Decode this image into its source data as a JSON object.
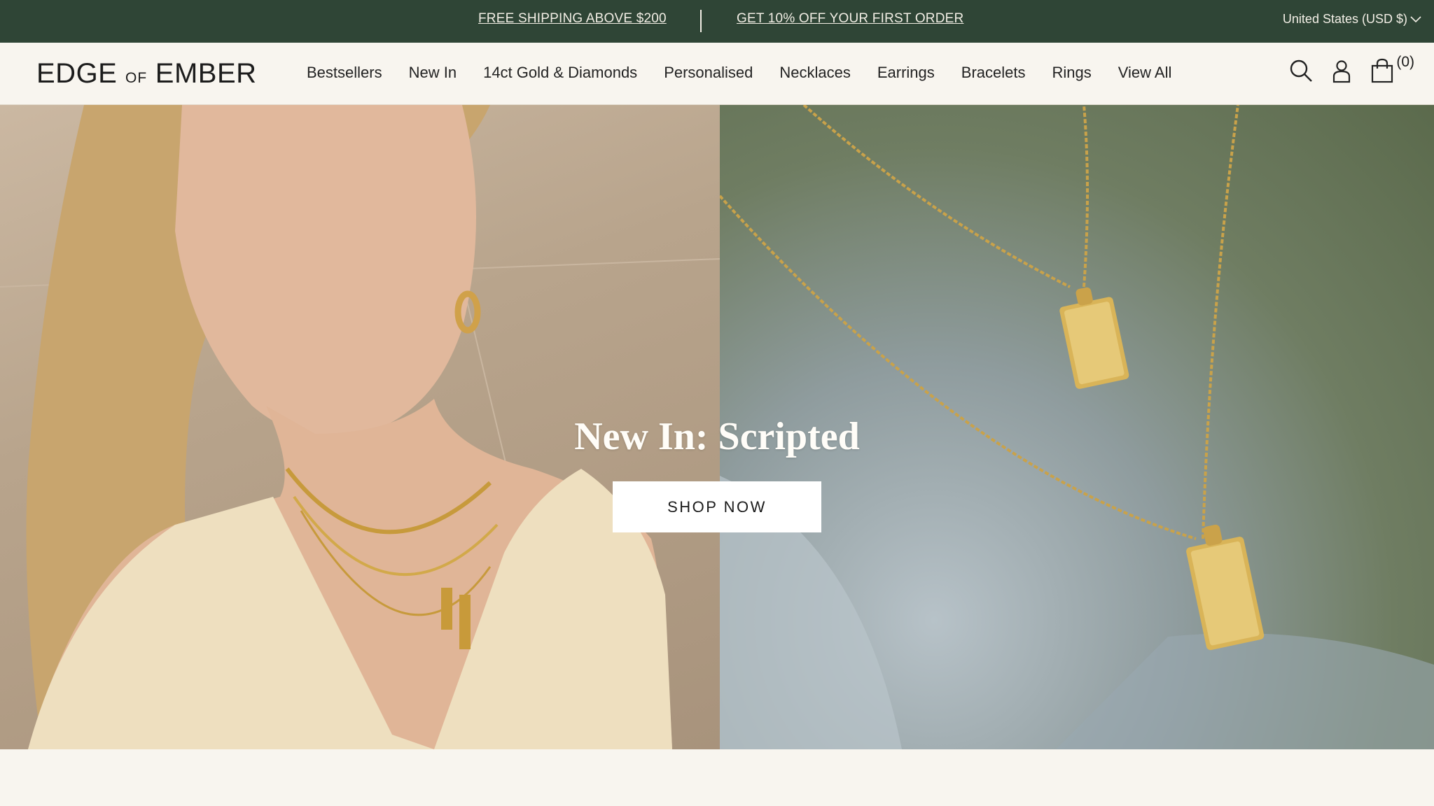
{
  "announcement": {
    "promo_1": "FREE SHIPPING ABOVE $200",
    "promo_2": "GET 10% OFF YOUR FIRST ORDER",
    "currency": "United States (USD $)",
    "bg_color": "#2f4536"
  },
  "header": {
    "logo_main_1": "EDGE",
    "logo_of": "of",
    "logo_main_2": "EMBER",
    "nav": [
      "Bestsellers",
      "New In",
      "14ct Gold & Diamonds",
      "Personalised",
      "Necklaces",
      "Earrings",
      "Bracelets",
      "Rings",
      "View All"
    ],
    "cart_count": "(0)",
    "icons": [
      "search-icon",
      "account-icon",
      "cart-icon"
    ]
  },
  "hero": {
    "headline": "New In: Scripted",
    "cta": "SHOP NOW"
  }
}
